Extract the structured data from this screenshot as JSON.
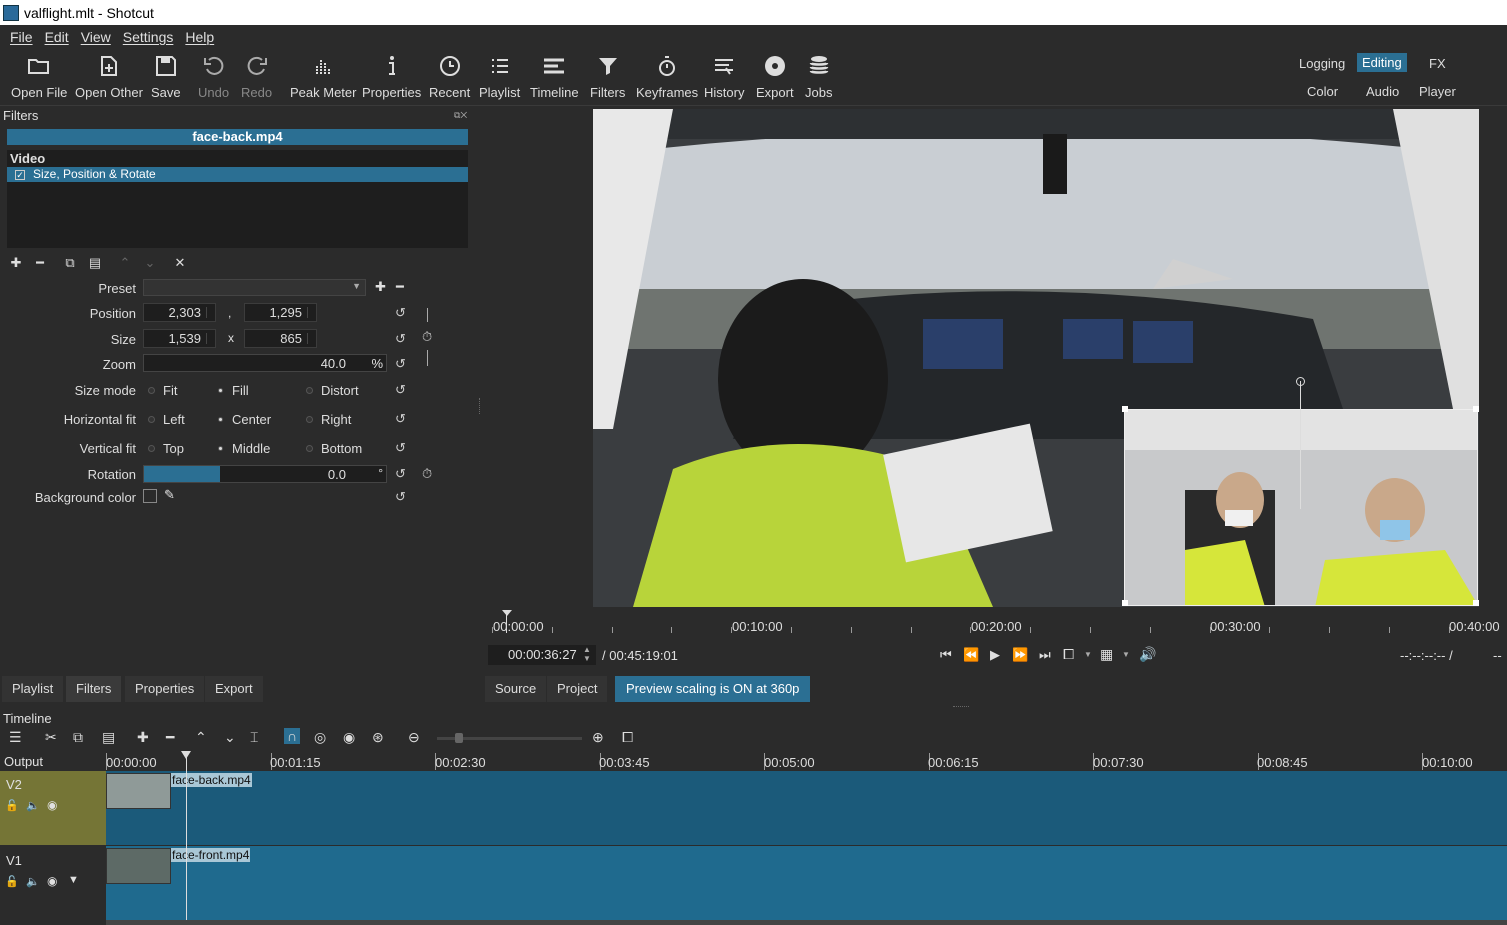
{
  "window": {
    "title": "valflight.mlt - Shotcut"
  },
  "menu": [
    "File",
    "Edit",
    "View",
    "Settings",
    "Help"
  ],
  "toolbar": [
    {
      "label": "Open File",
      "icon": "folder-open-icon"
    },
    {
      "label": "Open Other",
      "icon": "open-other-icon"
    },
    {
      "label": "Save",
      "icon": "save-icon"
    },
    {
      "label": "Undo",
      "icon": "undo-icon",
      "disabled": true
    },
    {
      "label": "Redo",
      "icon": "redo-icon",
      "disabled": true
    },
    {
      "label": "Peak Meter",
      "icon": "peak-meter-icon"
    },
    {
      "label": "Properties",
      "icon": "info-icon"
    },
    {
      "label": "Recent",
      "icon": "clock-icon"
    },
    {
      "label": "Playlist",
      "icon": "list-icon"
    },
    {
      "label": "Timeline",
      "icon": "timeline-icon"
    },
    {
      "label": "Filters",
      "icon": "funnel-icon"
    },
    {
      "label": "Keyframes",
      "icon": "stopwatch-icon"
    },
    {
      "label": "History",
      "icon": "history-icon"
    },
    {
      "label": "Export",
      "icon": "disc-icon"
    },
    {
      "label": "Jobs",
      "icon": "database-icon"
    }
  ],
  "layouts": {
    "row1": [
      "Logging",
      "Editing",
      "FX"
    ],
    "row2": [
      "Color",
      "Audio",
      "Player"
    ],
    "active": "Editing"
  },
  "filters": {
    "panel_title": "Filters",
    "clip_name": "face-back.mp4",
    "group": "Video",
    "items": [
      {
        "label": "Size, Position & Rotate",
        "checked": true
      }
    ],
    "preset_label": "Preset",
    "position": {
      "label": "Position",
      "x": "2,303",
      "sep": ",",
      "y": "1,295"
    },
    "size": {
      "label": "Size",
      "w": "1,539",
      "sep": "x",
      "h": "865"
    },
    "zoom": {
      "label": "Zoom",
      "value": "40.0",
      "unit": "%",
      "fraction": 0.4
    },
    "size_mode": {
      "label": "Size mode",
      "options": [
        "Fit",
        "Fill",
        "Distort"
      ],
      "selected": "Fill"
    },
    "hfit": {
      "label": "Horizontal fit",
      "options": [
        "Left",
        "Center",
        "Right"
      ],
      "selected": "Center"
    },
    "vfit": {
      "label": "Vertical fit",
      "options": [
        "Top",
        "Middle",
        "Bottom"
      ],
      "selected": "Middle"
    },
    "rotation": {
      "label": "Rotation",
      "value": "0.0",
      "unit": "°"
    },
    "bgcolor": {
      "label": "Background color"
    }
  },
  "player": {
    "ruler": [
      "00:00:00",
      "00:10:00",
      "00:20:00",
      "00:30:00",
      "00:40:00"
    ],
    "timecode": "00:00:36:27",
    "duration": "/ 00:45:19:01",
    "in_out": "--:--:--:-- /",
    "tabs": [
      "Source",
      "Project"
    ],
    "preview_scaling": "Preview scaling is ON at 360p"
  },
  "bottom_tabs": [
    "Playlist",
    "Filters",
    "Properties",
    "Export"
  ],
  "timeline": {
    "title": "Timeline",
    "output_label": "Output",
    "ruler": [
      "00:00:00",
      "00:01:15",
      "00:02:30",
      "00:03:45",
      "00:05:00",
      "00:06:15",
      "00:07:30",
      "00:08:45",
      "00:10:00"
    ],
    "tracks": [
      {
        "name": "V2",
        "clip": "face-back.mp4"
      },
      {
        "name": "V1",
        "clip": "face-front.mp4"
      }
    ]
  },
  "colors": {
    "accent": "#2b6f93",
    "track_selected": "#757536",
    "clip": "#1b5a7a"
  }
}
